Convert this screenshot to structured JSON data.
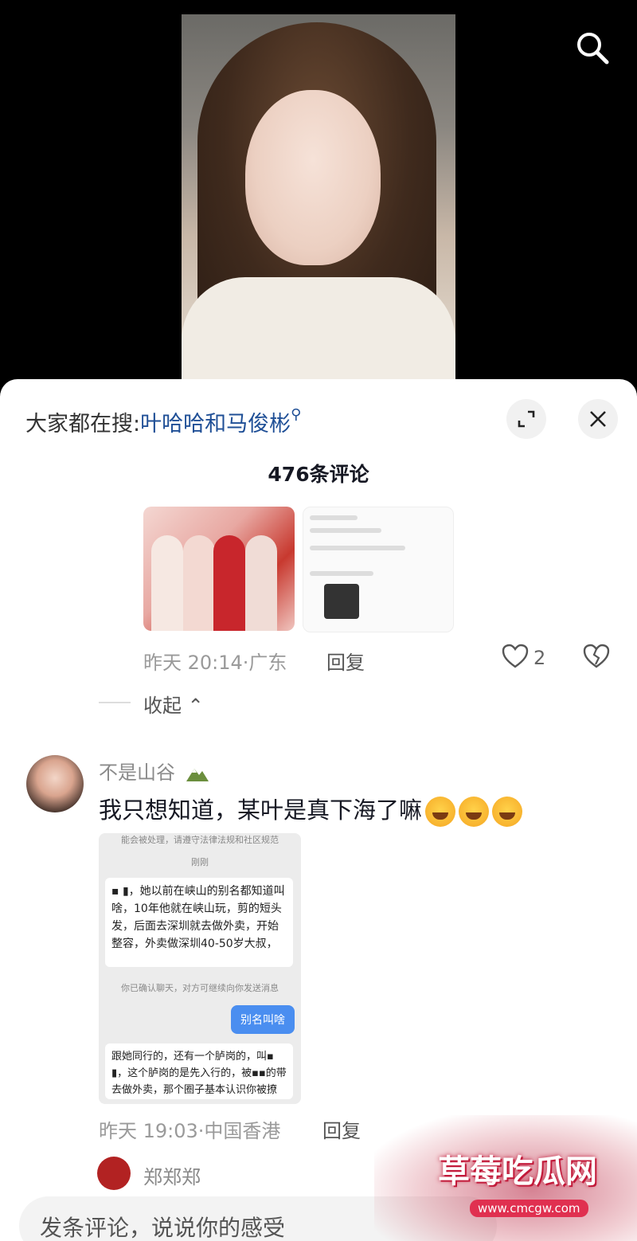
{
  "trending": {
    "prefix": "大家都在搜:",
    "keyword": "叶哈哈和马俊彬"
  },
  "comments_count": "476条评论",
  "reply1": {
    "time": "昨天 20:14·",
    "location": "广东",
    "reply_label": "回复",
    "likes": "2"
  },
  "collapse_label": "收起",
  "comment2": {
    "username": "不是山谷",
    "text": "我只想知道，某叶是真下海了嘛",
    "time": "昨天 19:03·",
    "location": "中国香港",
    "reply_label": "回复",
    "chat": {
      "top_sys": "能会被处理，请遵守法律法规和社区规范",
      "time_sys": "刚刚",
      "msg1": "▪ ▮，她以前在峡山的别名都知道叫啥，10年他就在峡山玩，剪的短头发，后面去深圳就去做外卖，开始整容，外卖做深圳40-50岁大叔，",
      "confirm_sys": "你已确认聊天，对方可继续向你发送消息",
      "sent": "别名叫啥",
      "msg2": "跟她同行的，还有一个胪岗的，叫▪ ▮，这个胪岗的是先入行的，被▪▪的带去做外卖，那个圈子基本认识你被撩的这个"
    }
  },
  "comment3": {
    "username": "郑郑郑"
  },
  "input_placeholder": "发条评论，说说你的感受",
  "watermark": {
    "title": "草莓吃瓜网",
    "url": "www.cmcgw.com"
  },
  "colors": {
    "keyword": "#1f4f96",
    "sheet_bg": "#ffffff",
    "text_main": "#161823"
  }
}
